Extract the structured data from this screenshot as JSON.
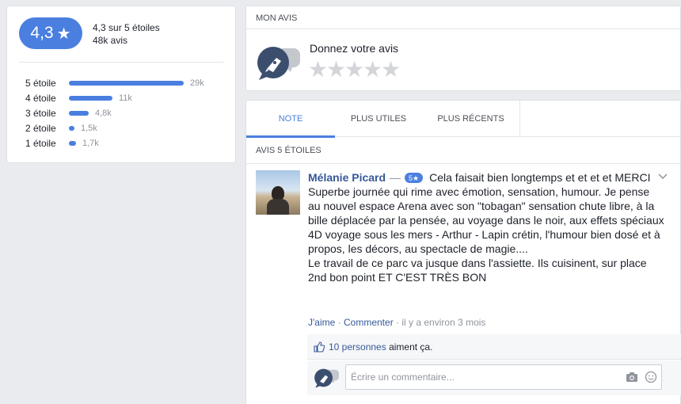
{
  "summary": {
    "score": "4,3",
    "score_star": "★",
    "out_of": "4,3 sur 5 étoiles",
    "count": "48k avis",
    "rows": [
      {
        "label": "5 étoile",
        "count": "29k",
        "fraction": 1.0
      },
      {
        "label": "4 étoile",
        "count": "11k",
        "fraction": 0.38
      },
      {
        "label": "3 étoile",
        "count": "4,8k",
        "fraction": 0.17
      },
      {
        "label": "2 étoile",
        "count": "1,5k",
        "fraction": 0.05
      },
      {
        "label": "1 étoile",
        "count": "1,7k",
        "fraction": 0.06
      }
    ]
  },
  "my_review": {
    "header": "MON AVIS",
    "title": "Donnez votre avis",
    "stars": [
      "★",
      "★",
      "★",
      "★",
      "★"
    ]
  },
  "reviews": {
    "tabs": [
      {
        "label": "NOTE",
        "active": true
      },
      {
        "label": "PLUS UTILES",
        "active": false
      },
      {
        "label": "PLUS RÉCENTS",
        "active": false
      }
    ],
    "section_label": "AVIS 5 ÉTOILES",
    "review": {
      "author": "Mélanie Picard",
      "dash": "—",
      "badge": "5★",
      "headline": "Cela faisait bien longtemps et et et et MERCI",
      "text": "Superbe journée qui rime avec émotion, sensation, humour. Je pense au nouvel espace Arena avec son \"tobagan\" sensation chute libre, à la bille déplacée par la pensée, au voyage dans le noir, aux effets spéciaux 4D voyage sous les mers - Arthur - Lapin crétin, l'humour bien dosé et à propos, les décors, au spectacle de magie....",
      "text2": "Le travail de ce parc va jusque dans l'assiette. Ils cuisinent, sur place 2nd bon point ET C'EST TRÈS BON",
      "like_label": "J'aime",
      "separator": "·",
      "comment_label": "Commenter",
      "time": "il y a environ 3 mois",
      "likes_count": "10 personnes",
      "likes_suffix": "aiment ça.",
      "comment_placeholder": "Écrire un commentaire..."
    }
  },
  "colors": {
    "accent": "#4a7fe0",
    "link": "#365899",
    "background": "#e9ebee"
  },
  "icons": [
    "pen-speech-icon",
    "thumbs-up-icon",
    "camera-icon",
    "smiley-icon",
    "chevron-down-icon"
  ]
}
